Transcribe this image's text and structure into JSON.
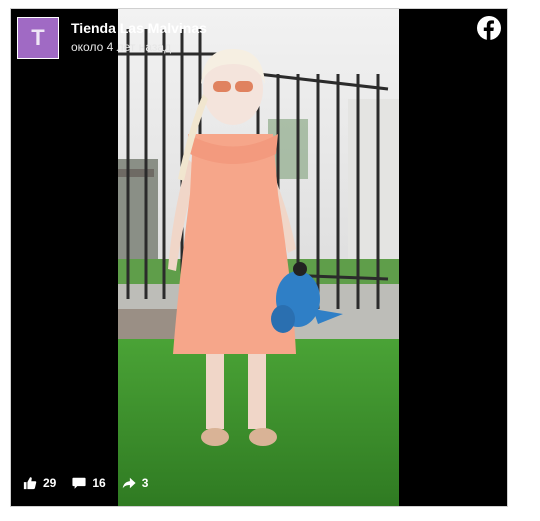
{
  "post": {
    "avatar_letter": "T",
    "page_name": "Tienda Las Malvinas",
    "time_ago": "около 4 лет назад"
  },
  "video": {
    "description": "Girl in a coral knit dress holding a blue plush toy, standing on grass in front of an iron gate"
  },
  "stats": {
    "likes": "29",
    "comments": "16",
    "shares": "3"
  },
  "colors": {
    "avatar_bg": "#a06ac4",
    "frame_bg": "#000000",
    "dress": "#f6a68a",
    "grass": "#3f9a2e"
  },
  "icons": [
    "facebook-icon",
    "like-icon",
    "comment-icon",
    "share-icon"
  ]
}
